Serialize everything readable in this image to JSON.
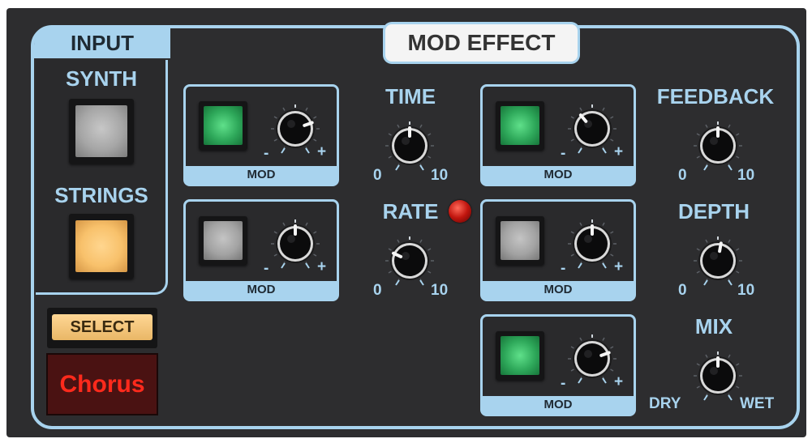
{
  "panel": {
    "title": "MOD EFFECT",
    "input_section": {
      "title": "INPUT",
      "synth_label": "SYNTH",
      "strings_label": "STRINGS"
    },
    "select_label": "SELECT",
    "preset_display": "Chorus"
  },
  "controls": {
    "time": {
      "label": "TIME",
      "min": "0",
      "max": "10"
    },
    "rate": {
      "label": "RATE",
      "min": "0",
      "max": "10"
    },
    "feedback": {
      "label": "FEEDBACK",
      "min": "0",
      "max": "10"
    },
    "depth": {
      "label": "DEPTH",
      "min": "0",
      "max": "10"
    },
    "mix": {
      "label": "MIX",
      "min": "DRY",
      "max": "WET"
    }
  },
  "mod_units": [
    {
      "label": "MOD",
      "minus": "-",
      "plus": "+",
      "led": "green"
    },
    {
      "label": "MOD",
      "minus": "-",
      "plus": "+",
      "led": "gray"
    },
    {
      "label": "MOD",
      "minus": "-",
      "plus": "+",
      "led": "green"
    },
    {
      "label": "MOD",
      "minus": "-",
      "plus": "+",
      "led": "gray"
    },
    {
      "label": "MOD",
      "minus": "-",
      "plus": "+",
      "led": "green"
    }
  ],
  "colors": {
    "panel_bg": "#2d2d2f",
    "accent": "#a8d3ee",
    "led_green": "#2ea85a",
    "button_orange": "#f8c16b",
    "display_text": "#ff2a1c"
  }
}
